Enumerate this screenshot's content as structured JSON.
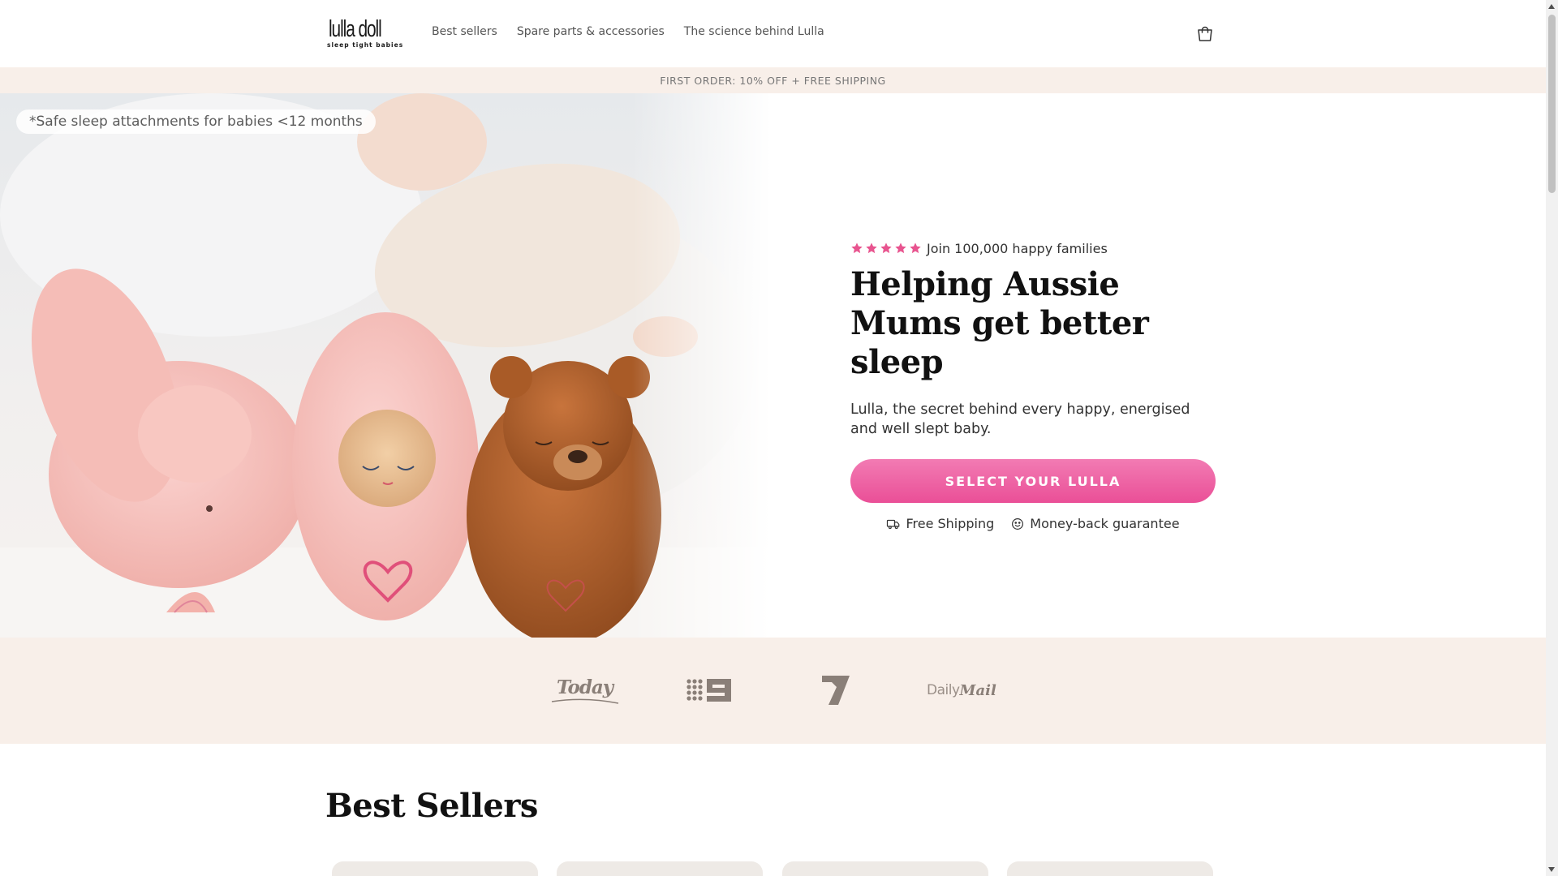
{
  "header": {
    "logo_text": "lulla doll",
    "logo_tagline": "sleep tight babies",
    "nav": [
      {
        "label": "Best sellers"
      },
      {
        "label": "Spare parts & accessories"
      },
      {
        "label": "The science behind Lulla"
      }
    ],
    "cart_icon": "cart-icon"
  },
  "announcement": "FIRST ORDER: 10% OFF + FREE SHIPPING",
  "hero": {
    "safe_note": "*Safe sleep attachments for babies <12 months",
    "rating": {
      "stars": 5,
      "text": "Join 100,000 happy families"
    },
    "title": "Helping Aussie Mums get better sleep",
    "subtitle": "Lulla, the secret behind every happy, energised and well slept baby.",
    "cta_label": "SELECT YOUR LULLA",
    "perks": [
      {
        "icon": "truck-icon",
        "label": "Free Shipping"
      },
      {
        "icon": "smile-icon",
        "label": "Money-back guarantee"
      }
    ]
  },
  "press": {
    "logos": [
      {
        "name": "Today",
        "text": "Today"
      },
      {
        "name": "Nine",
        "text": ""
      },
      {
        "name": "Seven",
        "text": ""
      },
      {
        "name": "Daily Mail",
        "text_a": "Daily",
        "text_b": "Mail"
      }
    ]
  },
  "best_sellers": {
    "title": "Best Sellers"
  },
  "colors": {
    "accent_pink": "#ea4f97",
    "announce_bg": "#f8efe9",
    "star_pink": "#e8548f"
  }
}
